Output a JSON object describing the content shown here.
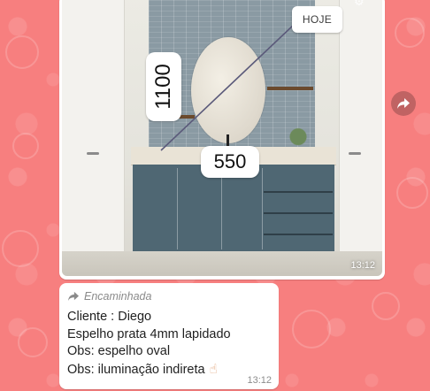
{
  "colors": {
    "chat_background": "#f77f7f",
    "bubble": "#ffffff",
    "forwarded_label": "#8a8a8a",
    "timestamp": "#8c8c8c"
  },
  "image_message": {
    "annotation_height": "1100",
    "annotation_width": "550",
    "sticker_label": "HOJE",
    "time": "13:12",
    "top_icon": "settings-icon"
  },
  "forward_button": {
    "icon": "share-arrow-icon"
  },
  "text_message": {
    "forwarded_label": "Encaminhada",
    "forwarded_icon": "forward-arrow-icon",
    "lines": [
      "Cliente : Diego",
      "Espelho prata 4mm lapidado",
      "Obs: espelho oval",
      "Obs: iluminação indireta"
    ],
    "emoji": "pointing-hand-emoji",
    "time": "13:12"
  }
}
